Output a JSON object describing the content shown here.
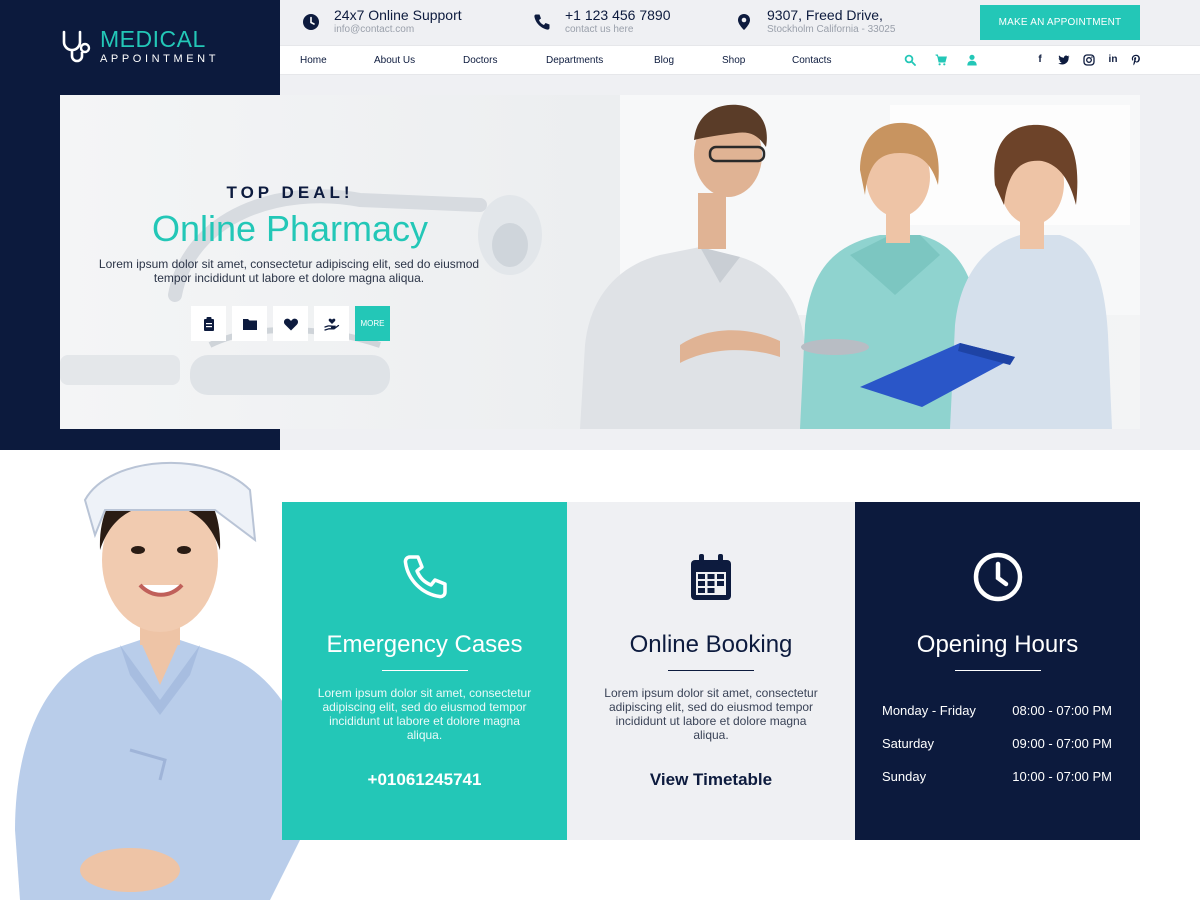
{
  "brand": {
    "name": "MEDICAL",
    "tagline": "APPOINTMENT"
  },
  "colors": {
    "accent": "#23c7b7",
    "navy": "#0c1a3d",
    "light": "#eff0f3"
  },
  "topbar": {
    "support": {
      "icon": "clock-icon",
      "title": "24x7 Online Support",
      "sub": "info@contact.com"
    },
    "phone": {
      "icon": "phone-icon",
      "title": "+1 123 456 7890",
      "sub": "contact us here"
    },
    "address": {
      "icon": "map-pin-icon",
      "title": "9307, Freed Drive,",
      "sub": "Stockholm California - 33025"
    },
    "cta_label": "MAKE AN APPOINTMENT"
  },
  "nav": {
    "items": [
      "Home",
      "About Us",
      "Doctors",
      "Departments",
      "Blog",
      "Shop",
      "Contacts"
    ],
    "tools": [
      "search-icon",
      "cart-icon",
      "user-icon"
    ],
    "social": [
      "f",
      "t",
      "ig",
      "in",
      "p"
    ]
  },
  "hero": {
    "overline": "TOP DEAL!",
    "title": "Online Pharmacy",
    "description": "Lorem ipsum dolor sit amet, consectetur adipiscing elit, sed do eiusmod tempor incididunt ut labore et dolore magna aliqua.",
    "buttons": [
      "clipboard-icon",
      "folder-icon",
      "heart-icon",
      "hand-heart-icon"
    ],
    "more_label": "MORE"
  },
  "cards": {
    "emergency": {
      "icon": "phone-icon",
      "title": "Emergency Cases",
      "text": "Lorem ipsum dolor sit amet, consectetur adipiscing elit, sed do eiusmod tempor incididunt ut labore et dolore magna aliqua.",
      "link": "+01061245741"
    },
    "booking": {
      "icon": "calendar-icon",
      "title": "Online Booking",
      "text": "Lorem ipsum dolor sit amet, consectetur adipiscing elit, sed do eiusmod tempor incididunt ut labore et dolore magna aliqua.",
      "link": "View Timetable"
    },
    "hours": {
      "icon": "clock-icon",
      "title": "Opening Hours",
      "rows": [
        {
          "day": "Monday - Friday",
          "time": "08:00 - 07:00 PM"
        },
        {
          "day": "Saturday",
          "time": "09:00 - 07:00 PM"
        },
        {
          "day": "Sunday",
          "time": "10:00 - 07:00 PM"
        }
      ]
    }
  }
}
